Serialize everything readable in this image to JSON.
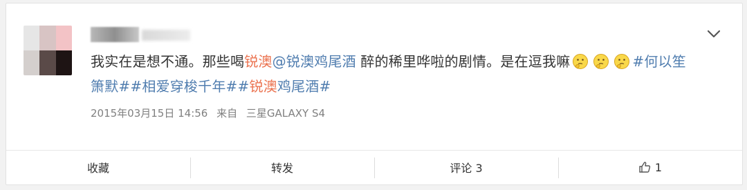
{
  "post": {
    "content": [
      {
        "type": "text",
        "text": "我实在是想不通。那些喝"
      },
      {
        "type": "kw",
        "text": "锐澳"
      },
      {
        "type": "link",
        "text": "@锐澳"
      },
      {
        "type": "link",
        "text": "鸡尾酒"
      },
      {
        "type": "text",
        "text": " 醉的稀里哗啦的剧情。是在逗我嘛"
      },
      {
        "type": "emoji",
        "icon": "thinking-emoji-icon"
      },
      {
        "type": "emoji",
        "icon": "thinking-emoji-icon"
      },
      {
        "type": "emoji",
        "icon": "thinking-emoji-icon"
      },
      {
        "type": "link",
        "text": "#何以笙箫默#"
      },
      {
        "type": "link",
        "text": "#相爱穿梭千年#"
      },
      {
        "type": "link",
        "text": "#"
      },
      {
        "type": "kw",
        "text": "锐澳"
      },
      {
        "type": "link",
        "text": "鸡尾酒#"
      }
    ],
    "date": "2015年03月15日 14:56",
    "source_prefix": "来自",
    "source": "三星GALAXY S4"
  },
  "actions": {
    "favorite": "收藏",
    "repost": "转发",
    "comment": "评论 3",
    "like": "1"
  },
  "colors": {
    "keyword": "#eb7350",
    "link": "#507daf",
    "meta": "#808080"
  }
}
